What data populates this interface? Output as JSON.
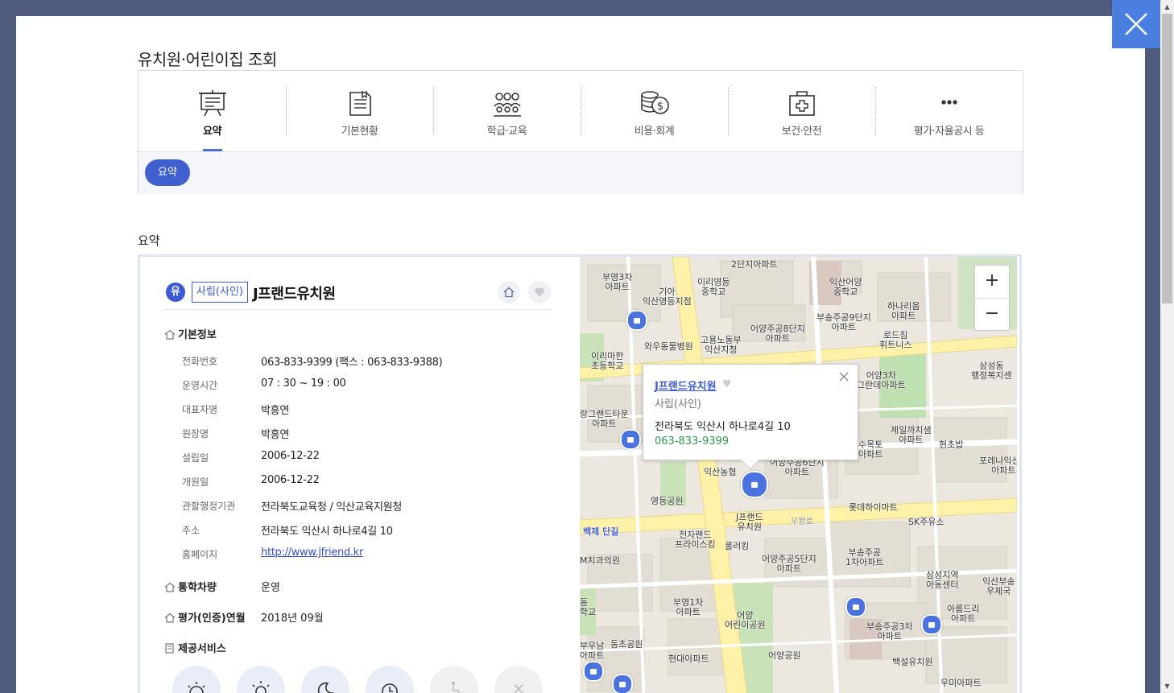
{
  "page": {
    "title": "유치원·어린이집 조회",
    "section_title": "요약"
  },
  "tabs": [
    {
      "label": "요약",
      "icon": "presentation-board-icon",
      "active": true
    },
    {
      "label": "기본현황",
      "icon": "document-icon"
    },
    {
      "label": "학급·교육",
      "icon": "group-icon"
    },
    {
      "label": "비용·회계",
      "icon": "coins-icon"
    },
    {
      "label": "보건·안전",
      "icon": "first-aid-kit-icon"
    },
    {
      "label": "평가·자율공시 등",
      "icon": "more-icon"
    }
  ],
  "subtab": {
    "label": "요약"
  },
  "facility": {
    "kind_short": "유",
    "type_badge": "사립(사인)",
    "name": "J프랜드유치원",
    "basic_info_title": "기본정보",
    "fields": [
      {
        "key": "전화번호",
        "value": "063-833-9399 (팩스 : 063-833-9388)"
      },
      {
        "key": "운영시간",
        "value": "07 : 30 ~ 19 : 00"
      },
      {
        "key": "대표자명",
        "value": "박흥연"
      },
      {
        "key": "원장명",
        "value": "박흥연"
      },
      {
        "key": "설립일",
        "value": "2006-12-22"
      },
      {
        "key": "개원일",
        "value": "2006-12-22"
      },
      {
        "key": "관할행정기관",
        "value": "전라북도교육청 / 익산교육지원청"
      },
      {
        "key": "주소",
        "value": "전라북도 익산시 하나로4길 10"
      },
      {
        "key": "홈페이지",
        "value": "http://www.jfriend.kr"
      }
    ],
    "bus_title": "통학차량",
    "bus_value": "운영",
    "eval_title": "평가(인증)연월",
    "eval_value": "2018년 09월",
    "services_title": "제공서비스"
  },
  "map": {
    "zoom_in": "+",
    "zoom_out": "−",
    "popup": {
      "name": "J프랜드유치원",
      "heart": "♥",
      "kind": "사립(사인)",
      "address": "전라북도 익산시 하나로4길 10",
      "phone": "063-833-9399"
    },
    "labels": {
      "l1": "2단지아파트",
      "l2": "부영3차\n아파트",
      "l3": "이리영등\n중학교",
      "l4": "익산어양\n중학교",
      "l5": "기아\n익산영등지점",
      "l6": "부송주공9단지\n아파트",
      "l7": "하나리움\n아파트",
      "l8": "어양주공8단지\n아파트",
      "l9": "고용노동부\n익산지청",
      "l10": "와우동물병원",
      "l11": "로드짐\n휘트니스",
      "l12": "이리마한\n초등학교",
      "l13": "삼성동\n행정복지센",
      "l14": "랑그랜드타운\n아파트",
      "l15": "어양3차\n그란데아파트",
      "l16": "제일까치샘\n아파트",
      "l17": "수목토\n아파트",
      "l18": "현초밥",
      "l19": "포레나익산부\n아파트",
      "l20": "익산농협",
      "l21": "어양주공6단지\n아파트",
      "l22": "영등공원",
      "l23": "J프랜드\n유치원",
      "l24": "롯데하이마트",
      "l25": "백제 단길",
      "l26": "전자랜드\n프라이스킹",
      "l27": "롤러킹",
      "l28": "SK주유소",
      "l29": "M치과의원",
      "l30": "어양주공5단지\n아파트",
      "l31": "부송주공\n1차아파트",
      "l32": "삼성지역\n아동센터",
      "l33": "익산부송\n우체국",
      "l34": "부영1차\n아파트",
      "l35": "어양\n어린이공원",
      "l36": "부송주공3차\n아파트",
      "l37": "아름드리\n아파트",
      "l38": "동\n학교",
      "l39": "동초공원",
      "l40": "현대아파트",
      "l41": "어양공원",
      "l42": "백설유치원",
      "l43": "우미아파트",
      "l44": "부우남\n아파트",
      "l45": "무왕로"
    }
  }
}
